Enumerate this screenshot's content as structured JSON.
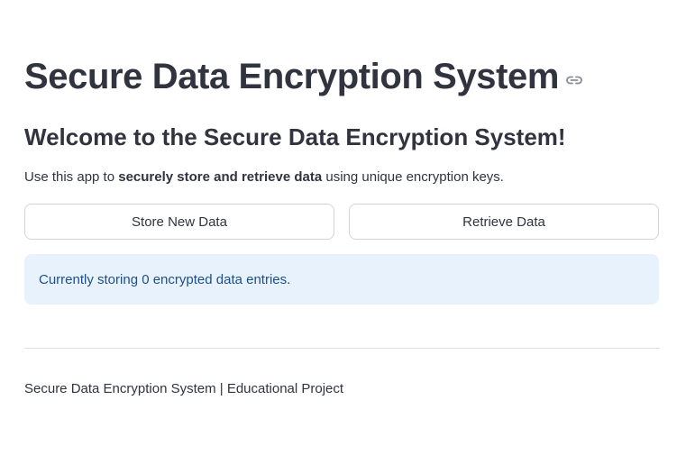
{
  "header": {
    "title": "Secure Data Encryption System",
    "link_icon": "link-icon"
  },
  "main": {
    "subtitle": "Welcome to the Secure Data Encryption System!",
    "intro": {
      "prefix": "Use this app to ",
      "bold": "securely store and retrieve data",
      "suffix": " using unique encryption keys."
    },
    "buttons": {
      "store_label": "Store New Data",
      "retrieve_label": "Retrieve Data"
    },
    "info_message": "Currently storing 0 encrypted data entries."
  },
  "footer": {
    "text": "Secure Data Encryption System | Educational Project"
  },
  "colors": {
    "text": "#31333f",
    "info_bg": "#e8f2fc",
    "info_text": "#1d4f8a",
    "border": "#d3d4d9"
  }
}
